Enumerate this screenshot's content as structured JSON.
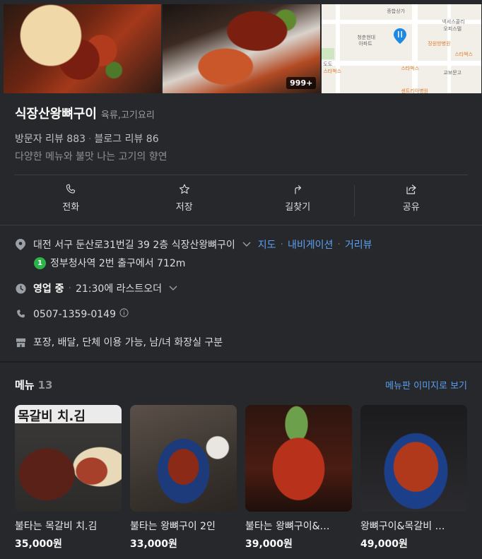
{
  "photos": {
    "more_count": "999+"
  },
  "map": {
    "labels": [
      "종합상가",
      "넥서스콜리",
      "오피스텔",
      "청춘현대",
      "아파트",
      "장원방병원",
      "스타벅스",
      "스타벅스",
      "교보문고",
      "도도",
      "스타벅스",
      "센트리아병원"
    ]
  },
  "place": {
    "name": "식장산왕뼈구이",
    "category": "육류,고기요리",
    "visitor_reviews": "방문자 리뷰 883",
    "blog_reviews": "블로그 리뷰 86",
    "description": "다양한 메뉴와 불맛 나는 고기의 향연"
  },
  "actions": [
    {
      "label": "전화",
      "icon": "phone-icon"
    },
    {
      "label": "저장",
      "icon": "star-icon"
    },
    {
      "label": "길찾기",
      "icon": "directions-icon"
    },
    {
      "label": "공유",
      "icon": "share-icon"
    }
  ],
  "info": {
    "address": "대전 서구 둔산로31번길 39 2층 식장산왕뼈구이",
    "map_link": "지도",
    "nav_link": "내비게이션",
    "street_link": "거리뷰",
    "subway_line": "1",
    "subway_text": "정부청사역 2번 출구에서 712m",
    "open_status": "영업 중",
    "open_detail": "21:30에 라스트오더",
    "phone": "0507-1359-0149",
    "amenities": "포장, 배달, 단체 이용 가능, 남/녀 화장실 구분"
  },
  "menu": {
    "title": "메뉴",
    "count": "13",
    "view_link": "메뉴판 이미지로 보기",
    "items": [
      {
        "name": "불타는 목갈비 치.김",
        "price": "35,000원",
        "banner": "목갈비 치.김"
      },
      {
        "name": "불타는 왕뼈구이 2인",
        "price": "33,000원"
      },
      {
        "name": "불타는 왕뼈구이&…",
        "price": "39,000원"
      },
      {
        "name": "왕뼈구이&목갈비 …",
        "price": "49,000원"
      }
    ]
  }
}
